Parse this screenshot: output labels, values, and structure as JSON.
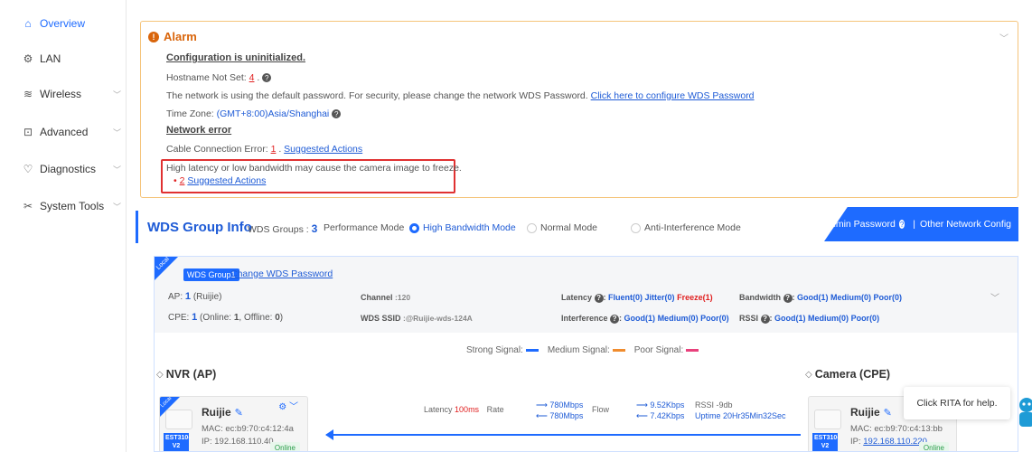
{
  "sidebar": {
    "items": [
      {
        "label": "Overview",
        "icon": "home-icon",
        "active": true
      },
      {
        "label": "LAN",
        "icon": "lan-icon"
      },
      {
        "label": "Wireless",
        "icon": "wifi-icon",
        "chevron": true
      },
      {
        "label": "Advanced",
        "icon": "advanced-icon",
        "chevron": true
      },
      {
        "label": "Diagnostics",
        "icon": "diagnostics-icon",
        "chevron": true
      },
      {
        "label": "System Tools",
        "icon": "tools-icon",
        "chevron": true
      }
    ]
  },
  "alarm": {
    "title": "Alarm",
    "config_heading": "Configuration is uninitialized.",
    "hostname_text": "Hostname Not Set:",
    "hostname_count": "4",
    "password_text": "The network is using the default password. For security, please change the network WDS Password.",
    "password_link": "Click here to configure WDS Password",
    "timezone_text": "Time Zone:",
    "timezone_value": "(GMT+8:00)Asia/Shanghai",
    "network_heading": "Network error",
    "cable_text": "Cable Connection Error:",
    "cable_count": "1",
    "cable_link": "Suggested Actions",
    "latency_text": "High latency or low bandwidth may cause the camera image to freeze.",
    "latency_count": "2",
    "latency_link": "Suggested Actions"
  },
  "wds": {
    "title": "WDS Group Info",
    "groups_label": "WDS Groups :",
    "groups_count": "3",
    "perf_label": "Performance Mode",
    "mode_high": "High Bandwidth Mode",
    "mode_normal": "Normal Mode",
    "mode_anti": "Anti-Interference Mode",
    "admin_label": "Admin Password",
    "other_label": "Other Network Config"
  },
  "group": {
    "local_label": "Local",
    "tag": "WDS Group1",
    "change_link": "Change WDS Password",
    "ap_label": "AP:",
    "ap_count": "1",
    "ap_brand": "(Ruijie)",
    "channel_label": "Channel",
    "channel_value": ":120",
    "latency_label": "Latency",
    "latency_fluent": "Fluent(0)",
    "latency_jitter": "Jitter(0)",
    "latency_freeze": "Freeze(1)",
    "bandwidth_label": "Bandwidth",
    "bw_good": "Good(1)",
    "bw_medium": "Medium(0)",
    "bw_poor": "Poor(0)",
    "cpe_label": "CPE:",
    "cpe_count": "1",
    "cpe_online_label": "(Online:",
    "cpe_online": "1",
    "cpe_offline_label": ", Offline:",
    "cpe_offline": "0",
    "ssid_label": "WDS SSID",
    "ssid_value": ":@Ruijie-wds-124A",
    "interference_label": "Interference",
    "if_good": "Good(1)",
    "if_medium": "Medium(0)",
    "if_poor": "Poor(0)",
    "rssi_label": "RSSI",
    "rssi_good": "Good(1)",
    "rssi_medium": "Medium(0)",
    "rssi_poor": "Poor(0)"
  },
  "legend": {
    "strong": "Strong Signal:",
    "medium": "Medium Signal:",
    "poor": "Poor Signal:",
    "colors": {
      "strong": "#1e6bff",
      "medium": "#f08c2e",
      "poor": "#e8417c"
    }
  },
  "nvr": {
    "title": "NVR (AP)",
    "local_label": "Local",
    "name": "Ruijie",
    "mac": "MAC:  ec:b9:70:c4:12:4a",
    "ip": "IP:  192.168.110.40",
    "model": "EST310-V2",
    "status": "Online"
  },
  "camera": {
    "title": "Camera (CPE)",
    "name": "Ruijie",
    "mac": "MAC:  ec:b9:70:c4:13:bb",
    "ip_prefix": "IP:",
    "ip": "192.168.110.220",
    "model": "EST310-V2",
    "status": "Online"
  },
  "link": {
    "latency_label": "Latency",
    "latency_value": "100ms",
    "rate_label": "Rate",
    "rate_up": "780Mbps",
    "rate_down": "780Mbps",
    "flow_label": "Flow",
    "flow_up": "9.52Kbps",
    "flow_down": "7.42Kbps",
    "rssi": "RSSI -9db",
    "uptime": "Uptime 20Hr35Min32Sec"
  },
  "rita": {
    "tip": "Click RITA for help."
  }
}
